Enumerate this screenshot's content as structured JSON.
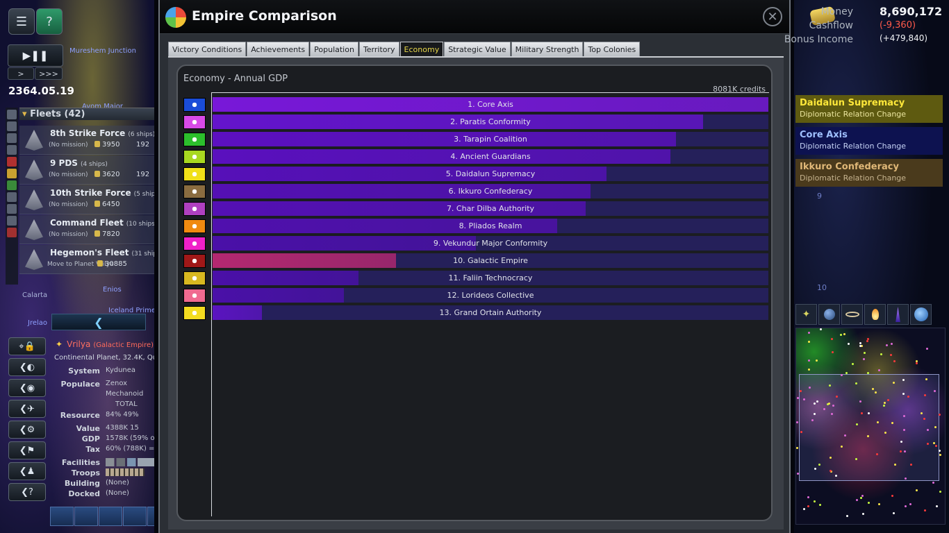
{
  "game_date": "2364.05.19",
  "speed": {
    "step": ">",
    "fast": ">>>"
  },
  "fleets": {
    "header": "Fleets (42)",
    "rows": [
      {
        "name": "8th Strike Force",
        "ships": "(6 ships)",
        "mission": "(No mission)",
        "strength": "3950",
        "extra": "192"
      },
      {
        "name": "9 PDS",
        "ships": "(4 ships)",
        "mission": "(No mission)",
        "strength": "3620",
        "extra": "192"
      },
      {
        "name": "10th Strike Force",
        "ships": "(5 ships)",
        "mission": "(No mission)",
        "strength": "6450",
        "extra": ""
      },
      {
        "name": "Command Fleet",
        "ships": "(10 ships)",
        "mission": "(No mission)",
        "strength": "7820",
        "extra": ""
      },
      {
        "name": "Hegemon's Fleet",
        "ships": "(31 ship",
        "mission": "Move to Planet Vrilya",
        "strength": "30885",
        "extra": ""
      }
    ]
  },
  "map_labels": {
    "l1": "Mureshem Junction",
    "l2": "Avom Major",
    "l3": "Calarta",
    "l4": "Iceland Prime",
    "l5": "Jrelao",
    "l6": "Enios"
  },
  "planet": {
    "name": "Vrilya",
    "empire": "(Galactic Empire)",
    "type": "Continental Planet, 32.4K, Qual",
    "rows": [
      {
        "key": "System",
        "value": "Kydunea"
      },
      {
        "key": "Populace",
        "value": "Zenox"
      },
      {
        "key": "",
        "value": "Mechanoid"
      },
      {
        "key": "",
        "value": "TOTAL"
      },
      {
        "key": "Resource",
        "value": "84%  49%"
      },
      {
        "key": "Value",
        "value": "4388K  15"
      },
      {
        "key": "GDP",
        "value": "1578K (59% of"
      },
      {
        "key": "Tax",
        "value": "60% (788K) = 1"
      },
      {
        "key": "Facilities",
        "value": ""
      },
      {
        "key": "Troops",
        "value": ""
      },
      {
        "key": "Building",
        "value": "(None)"
      },
      {
        "key": "Docked",
        "value": "(None)"
      }
    ]
  },
  "dialog": {
    "title": "Empire Comparison",
    "close_icon": "close-icon",
    "tabs": [
      "Victory Conditions",
      "Achievements",
      "Population",
      "Territory",
      "Economy",
      "Strategic Value",
      "Military Strength",
      "Top Colonies"
    ],
    "active_tab": "Economy"
  },
  "chart_data": {
    "type": "bar",
    "title": "Economy - Annual GDP",
    "max_label": "8081K credits",
    "orientation": "horizontal",
    "xlim": [
      0,
      8081
    ],
    "unit": "K credits",
    "categories": [
      "1. Core Axis",
      "2. Paratis Conformity",
      "3. Tarapin Coalition",
      "4. Ancient Guardians",
      "5. Daidalun Supremacy",
      "6. Ikkuro Confederacy",
      "7. Char Dilba Authority",
      "8. Pliados Realm",
      "9. Vekundur Major Conformity",
      "10. Galactic Empire",
      "11. Faliin Technocracy",
      "12. Lorideos Collective",
      "13. Grand Ortain Authority"
    ],
    "values": [
      8081,
      7130,
      6740,
      6660,
      5730,
      5500,
      5420,
      5010,
      3830,
      2670,
      2120,
      1910,
      720
    ],
    "bar_colors": [
      "#7818d8",
      "#6414cc",
      "#5c10c0",
      "#5a10be",
      "#5610b8",
      "#5410b4",
      "#5410b4",
      "#5010ae",
      "#4a10a8",
      "#b42870",
      "#4a10a8",
      "#4a10a8",
      "#5a14c0"
    ],
    "flag_colors": [
      "#1a4cd8",
      "#d84ae8",
      "#2cc02c",
      "#a8d820",
      "#f0e018",
      "#8a6c40",
      "#b040c0",
      "#f08a10",
      "#f020c8",
      "#a01818",
      "#d8b820",
      "#f06a90",
      "#f4dc20"
    ]
  },
  "treasury": {
    "money_label": "Money",
    "money": "8,690,172",
    "cashflow_label": "Cashflow",
    "cashflow": "(-9,360)",
    "bonus_label": "Bonus Income",
    "bonus": "(+479,840)"
  },
  "notifications": [
    {
      "title": "Daidalun Supremacy",
      "sub": "Diplomatic Relation Change",
      "bg": "#5e5a10",
      "title_color": "#ffe83a",
      "sub_color": "#ece6a0"
    },
    {
      "title": "Core Axis",
      "sub": "Diplomatic Relation Change",
      "bg": "#0d1250",
      "title_color": "#9fc0ff",
      "sub_color": "#c6d3f5"
    },
    {
      "title": "Ikkuro Confederacy",
      "sub": "Diplomatic Relation Change",
      "bg": "#4a3a1c",
      "title_color": "#e0b878",
      "sub_color": "#c8b590"
    }
  ],
  "grid_numbers": [
    "9",
    "10"
  ],
  "colors": {
    "accent_tab": "#e6d64a",
    "bar_track": "#25205a",
    "negative": "#ff5a4a"
  }
}
